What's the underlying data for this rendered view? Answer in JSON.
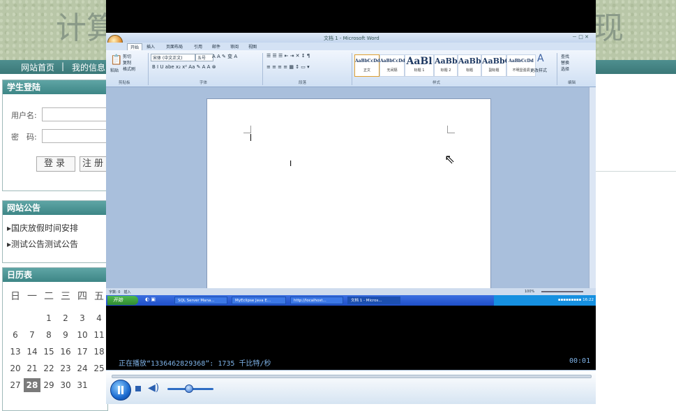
{
  "site": {
    "banner_left": "计算",
    "banner_right": "现",
    "nav": [
      "网站首页",
      "|",
      "我的信息"
    ]
  },
  "login": {
    "title": "学生登陆",
    "username_label": "用户名:",
    "password_label": "密　码:",
    "login_button": "登录",
    "register_button": "注册"
  },
  "notice": {
    "title": "网站公告",
    "items": [
      "国庆放假时间安排",
      "测试公告测试公告"
    ]
  },
  "calendar": {
    "title": "日历表",
    "weekdays": [
      "日",
      "一",
      "二",
      "三",
      "四",
      "五"
    ],
    "rows": [
      [
        "",
        "",
        "1",
        "2",
        "3",
        "4"
      ],
      [
        "6",
        "7",
        "8",
        "9",
        "10",
        "11"
      ],
      [
        "13",
        "14",
        "15",
        "16",
        "17",
        "18"
      ],
      [
        "20",
        "21",
        "22",
        "23",
        "24",
        "25"
      ],
      [
        "27",
        "28",
        "29",
        "30",
        "31",
        ""
      ]
    ],
    "today": "28"
  },
  "word": {
    "title": "文档 1 - Microsoft Word",
    "tabs": [
      "开始",
      "插入",
      "页面布局",
      "引用",
      "邮件",
      "审阅",
      "视图"
    ],
    "clipboard": {
      "paste": "粘贴",
      "cut": "剪切",
      "copy": "复制",
      "format_painter": "格式刷",
      "group": "剪贴板"
    },
    "font": {
      "name": "宋体 (中文正文)",
      "size": "五号",
      "group": "字体"
    },
    "paragraph_group": "段落",
    "styles": [
      {
        "sample": "AaBbCcDd",
        "name": "正文"
      },
      {
        "sample": "AaBbCcDd",
        "name": "无间隔"
      },
      {
        "sample": "AaBl",
        "name": "标题 1"
      },
      {
        "sample": "AaBbC",
        "name": "标题 2"
      },
      {
        "sample": "AaBbC",
        "name": "标题"
      },
      {
        "sample": "AaBbC",
        "name": "副标题"
      },
      {
        "sample": "AaBbCcDd",
        "name": "不明显强调"
      }
    ],
    "styles_group": "样式",
    "change_styles": "更改样式",
    "editing": {
      "find": "查找",
      "replace": "替换",
      "select": "选择",
      "group": "编辑"
    },
    "status_left": "字数: 0　插入",
    "status_zoom": "100%"
  },
  "taskbar": {
    "start": "开始",
    "items": [
      "SQL Server Mana...",
      "MyEclipse Java E...",
      "http://localhost...",
      "文档 1 - Micros..."
    ],
    "clock": "16:22"
  },
  "player": {
    "status": "正在播放“1336462829368”: 1735 千比特/秒",
    "time": "00:01",
    "volume_level": 0.45,
    "seek_position": 0.0
  }
}
